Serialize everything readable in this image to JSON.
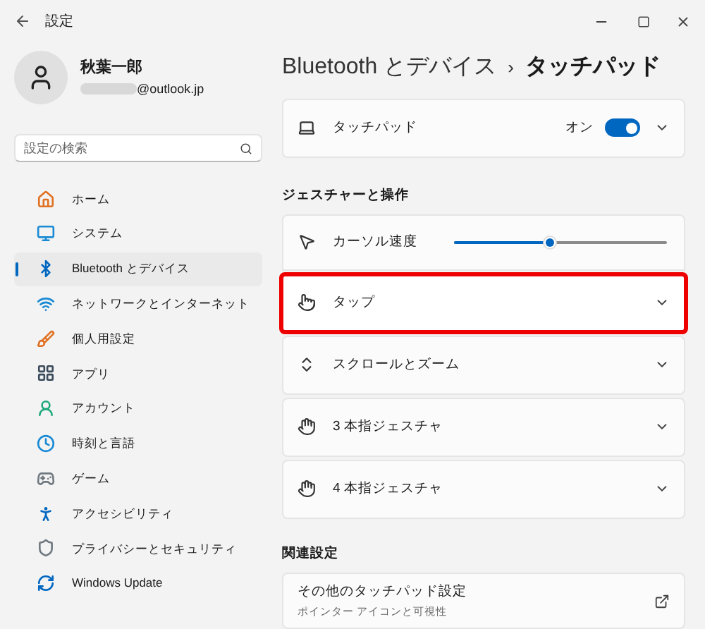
{
  "window": {
    "title": "設定"
  },
  "profile": {
    "name": "秋葉一郎",
    "email": "@outlook.jp"
  },
  "search": {
    "placeholder": "設定の検索"
  },
  "sidebar": {
    "items": [
      {
        "label": "ホーム",
        "kind": "home",
        "selected": false
      },
      {
        "label": "システム",
        "kind": "system",
        "selected": false
      },
      {
        "label": "Bluetooth とデバイス",
        "kind": "bluetooth",
        "selected": true
      },
      {
        "label": "ネットワークとインターネット",
        "kind": "network",
        "selected": false
      },
      {
        "label": "個人用設定",
        "kind": "personalize",
        "selected": false
      },
      {
        "label": "アプリ",
        "kind": "apps",
        "selected": false
      },
      {
        "label": "アカウント",
        "kind": "account",
        "selected": false
      },
      {
        "label": "時刻と言語",
        "kind": "time",
        "selected": false
      },
      {
        "label": "ゲーム",
        "kind": "game",
        "selected": false
      },
      {
        "label": "アクセシビリティ",
        "kind": "accessibility",
        "selected": false
      },
      {
        "label": "プライバシーとセキュリティ",
        "kind": "privacy",
        "selected": false
      },
      {
        "label": "Windows Update",
        "kind": "update",
        "selected": false
      }
    ]
  },
  "breadcrumb": {
    "parent": "Bluetooth とデバイス",
    "separator": "›",
    "current": "タッチパッド"
  },
  "touchpad_card": {
    "label": "タッチパッド",
    "state_text": "オン",
    "on": true
  },
  "gestures": {
    "heading": "ジェスチャーと操作",
    "items": [
      {
        "kind": "slider",
        "label": "カーソル速度",
        "level": 0.45,
        "highlighted": false
      },
      {
        "kind": "tap",
        "label": "タップ",
        "highlighted": true
      },
      {
        "kind": "scroll",
        "label": "スクロールとズーム",
        "highlighted": false
      },
      {
        "kind": "hand",
        "label": "3 本指ジェスチャ",
        "highlighted": false
      },
      {
        "kind": "hand",
        "label": "4 本指ジェスチャ",
        "highlighted": false
      }
    ]
  },
  "related": {
    "heading": "関連設定",
    "items": [
      {
        "title": "その他のタッチパッド設定",
        "subtitle": "ポインター アイコンと可視性"
      }
    ]
  }
}
